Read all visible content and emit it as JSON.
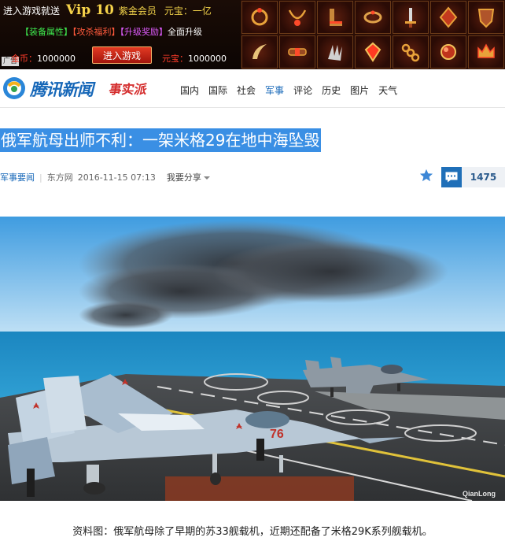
{
  "ad": {
    "line1_prefix": "进入游戏就送",
    "vip": "Vip 10",
    "vip_member": "紫金会员",
    "yuanbao_prefix": "元宝：一亿",
    "feature1": "【装备属性】",
    "feature2": "【攻杀福利】",
    "feature3": "【升级奖励】",
    "feature_suffix": "全面升级",
    "badge": "广告",
    "gold_label": "金币：",
    "gold_value": "1000000",
    "button": "进入游戏",
    "yuanbao_label": "元宝：",
    "yuanbao_value": "1000000",
    "items": [
      "ring-icon",
      "necklace-icon",
      "boots-icon",
      "bracelet-icon",
      "sword-icon",
      "amulet-icon",
      "shield-icon",
      "horn-icon",
      "belt-icon",
      "claw-icon",
      "gem-icon",
      "chain-icon",
      "orb-icon",
      "crown-icon"
    ]
  },
  "nav": {
    "logo_text": "腾讯新闻",
    "logo_sub": "事实派",
    "items": [
      "国内",
      "国际",
      "社会",
      "军事",
      "评论",
      "历史",
      "图片",
      "天气"
    ],
    "active_index": 3
  },
  "article": {
    "title": "俄军航母出师不利：一架米格29在地中海坠毁",
    "category": "军事要闻",
    "source": "东方网",
    "time": "2016-11-15 07:13",
    "share": "我要分享",
    "comment_count": "1475",
    "photo_watermark": "QianLong",
    "plane_number": "76",
    "caption": "资料图：俄军航母除了早期的苏33舰载机，近期还配备了米格29K系列舰载机。"
  },
  "colors": {
    "brand_blue": "#1667b8",
    "highlight": "#3a8fe4",
    "accent_red": "#d42b2b"
  }
}
